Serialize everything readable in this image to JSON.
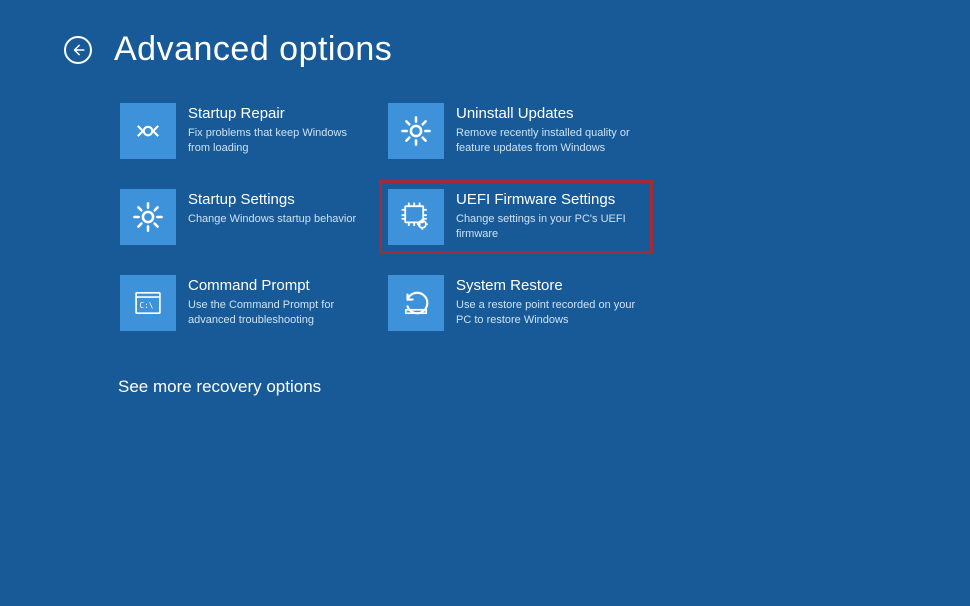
{
  "title": "Advanced options",
  "see_more": "See more recovery options",
  "options": [
    {
      "id": "startup-repair",
      "title": "Startup Repair",
      "desc": "Fix problems that keep Windows from loading",
      "highlight": false
    },
    {
      "id": "uninstall-updates",
      "title": "Uninstall Updates",
      "desc": "Remove recently installed quality or feature updates from Windows",
      "highlight": false
    },
    {
      "id": "startup-settings",
      "title": "Startup Settings",
      "desc": "Change Windows startup behavior",
      "highlight": false
    },
    {
      "id": "uefi-firmware",
      "title": "UEFI Firmware Settings",
      "desc": "Change settings in your PC's UEFI firmware",
      "highlight": true
    },
    {
      "id": "command-prompt",
      "title": "Command Prompt",
      "desc": "Use the Command Prompt for advanced troubleshooting",
      "highlight": false
    },
    {
      "id": "system-restore",
      "title": "System Restore",
      "desc": "Use a restore point recorded on your PC to restore Windows",
      "highlight": false
    }
  ]
}
